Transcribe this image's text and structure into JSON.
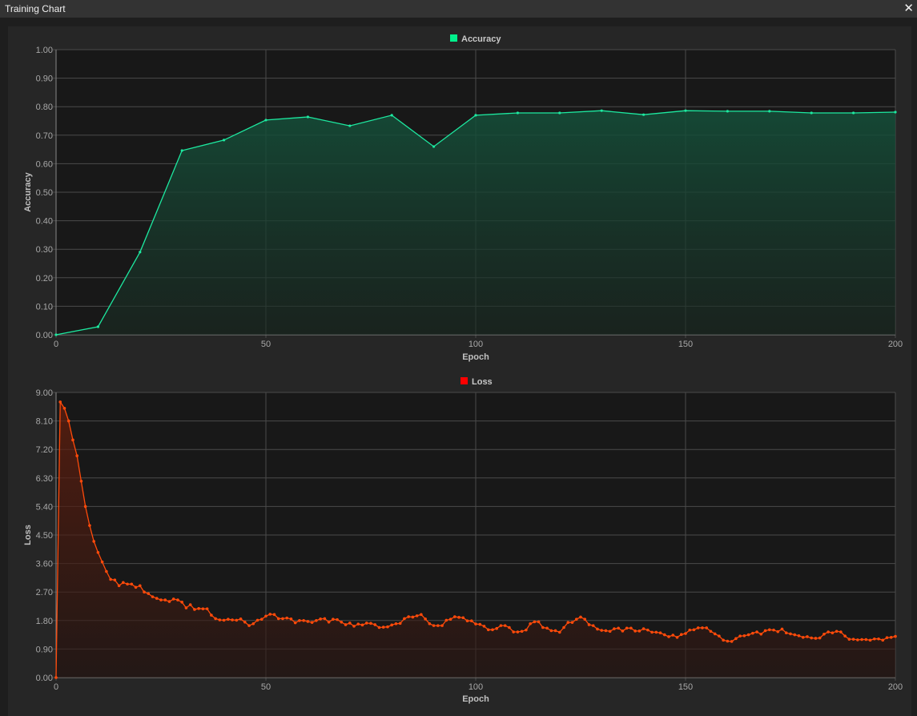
{
  "window": {
    "title": "Training Chart",
    "close_icon": "close-icon"
  },
  "chart_data": [
    {
      "type": "area",
      "title": "Accuracy",
      "legend": "Accuracy",
      "legend_placement": "top-center",
      "xlabel": "Epoch",
      "ylabel": "Accuracy",
      "xlim": [
        0,
        200
      ],
      "ylim": [
        0,
        1
      ],
      "xticks": [
        "0",
        "50",
        "100",
        "150",
        "200"
      ],
      "yticks": [
        "0.00",
        "0.10",
        "0.20",
        "0.30",
        "0.40",
        "0.50",
        "0.60",
        "0.70",
        "0.80",
        "0.90",
        "1.00"
      ],
      "grid": true,
      "color": "#1de9a0",
      "legend_color": "#00f08c",
      "x": [
        0,
        10,
        20,
        30,
        40,
        50,
        60,
        70,
        80,
        90,
        100,
        110,
        120,
        130,
        140,
        150,
        160,
        170,
        180,
        190,
        200
      ],
      "y": [
        0,
        0.028,
        0.29,
        0.646,
        0.683,
        0.753,
        0.764,
        0.733,
        0.77,
        0.66,
        0.77,
        0.778,
        0.778,
        0.786,
        0.772,
        0.786,
        0.784,
        0.784,
        0.778,
        0.778,
        0.781
      ]
    },
    {
      "type": "area",
      "title": "Loss",
      "legend": "Loss",
      "legend_placement": "top-center",
      "xlabel": "Epoch",
      "ylabel": "Loss",
      "xlim": [
        0,
        200
      ],
      "ylim": [
        0,
        9
      ],
      "xticks": [
        "0",
        "50",
        "100",
        "150",
        "200"
      ],
      "yticks": [
        "0.00",
        "0.90",
        "1.80",
        "2.70",
        "3.60",
        "4.50",
        "5.40",
        "6.30",
        "7.20",
        "8.10",
        "9.00"
      ],
      "grid": true,
      "color": "#ff4a0a",
      "legend_color": "#ff0000",
      "x_step": 1,
      "y": [
        0,
        8.7,
        8.5,
        8.1,
        7.5,
        7.0,
        6.2,
        5.4,
        4.8,
        4.3,
        3.95,
        3.65,
        3.35,
        3.1,
        3.08,
        2.9,
        3.0,
        2.95,
        2.95,
        2.85,
        2.9,
        2.7,
        2.65,
        2.55,
        2.5,
        2.45,
        2.45,
        2.4,
        2.48,
        2.45,
        2.38,
        2.2,
        2.3,
        2.15,
        2.18,
        2.17,
        2.17,
        1.97,
        1.86,
        1.82,
        1.81,
        1.84,
        1.82,
        1.81,
        1.85,
        1.75,
        1.64,
        1.7,
        1.81,
        1.84,
        1.94,
        2.0,
        1.99,
        1.86,
        1.86,
        1.88,
        1.85,
        1.73,
        1.8,
        1.8,
        1.77,
        1.74,
        1.8,
        1.85,
        1.86,
        1.75,
        1.84,
        1.83,
        1.75,
        1.67,
        1.72,
        1.62,
        1.69,
        1.66,
        1.72,
        1.71,
        1.67,
        1.58,
        1.59,
        1.6,
        1.66,
        1.7,
        1.71,
        1.86,
        1.92,
        1.91,
        1.95,
        1.99,
        1.85,
        1.7,
        1.64,
        1.64,
        1.64,
        1.81,
        1.84,
        1.92,
        1.9,
        1.89,
        1.79,
        1.79,
        1.69,
        1.68,
        1.62,
        1.51,
        1.51,
        1.55,
        1.64,
        1.64,
        1.58,
        1.44,
        1.44,
        1.46,
        1.5,
        1.7,
        1.76,
        1.76,
        1.58,
        1.56,
        1.48,
        1.48,
        1.43,
        1.58,
        1.74,
        1.74,
        1.84,
        1.91,
        1.84,
        1.67,
        1.64,
        1.53,
        1.49,
        1.48,
        1.46,
        1.54,
        1.56,
        1.47,
        1.56,
        1.56,
        1.47,
        1.47,
        1.54,
        1.5,
        1.43,
        1.43,
        1.41,
        1.35,
        1.29,
        1.34,
        1.27,
        1.36,
        1.39,
        1.5,
        1.51,
        1.57,
        1.57,
        1.57,
        1.46,
        1.38,
        1.31,
        1.18,
        1.15,
        1.14,
        1.23,
        1.31,
        1.32,
        1.35,
        1.4,
        1.44,
        1.37,
        1.48,
        1.51,
        1.5,
        1.45,
        1.53,
        1.41,
        1.38,
        1.35,
        1.32,
        1.27,
        1.29,
        1.25,
        1.24,
        1.25,
        1.37,
        1.44,
        1.41,
        1.46,
        1.44,
        1.31,
        1.21,
        1.21,
        1.19,
        1.2,
        1.2,
        1.18,
        1.22,
        1.22,
        1.18,
        1.26,
        1.27,
        1.3
      ]
    }
  ]
}
